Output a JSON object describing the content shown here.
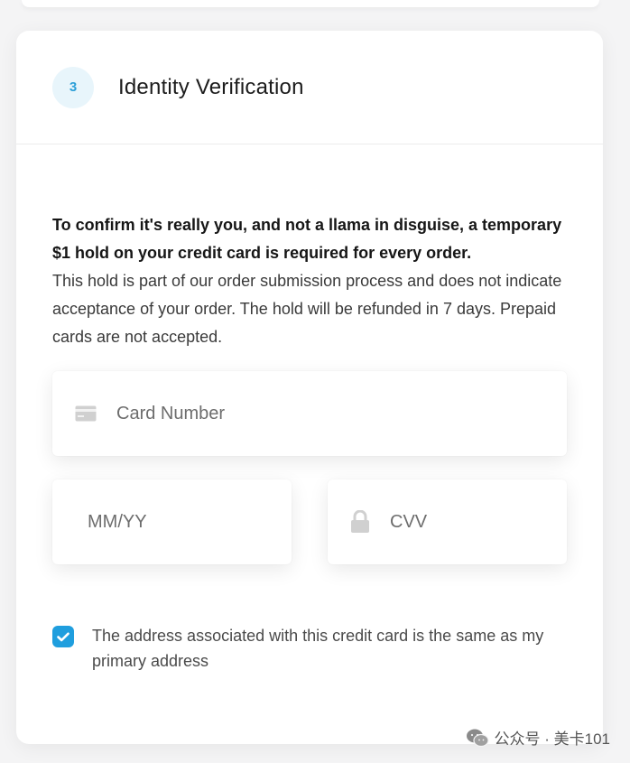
{
  "section": {
    "step_number": "3",
    "title": "Identity Verification"
  },
  "intro": {
    "bold": "To confirm it's really you, and not a llama in disguise, a temporary $1 hold on your credit card is required for every order.",
    "body": "This hold is part of our order submission process and does not indicate acceptance of your order. The hold will be refunded in 7 days. Prepaid cards are not accepted."
  },
  "fields": {
    "card_number_placeholder": "Card Number",
    "expiry_placeholder": "MM/YY",
    "cvv_placeholder": "CVV"
  },
  "checkbox": {
    "checked": true,
    "label": "The address associated with this credit card is the same as my primary address"
  },
  "watermark": {
    "text": "公众号 · 美卡101"
  },
  "colors": {
    "accent": "#1f9ede",
    "step_circle_bg": "#e8f5fb"
  },
  "icons": {
    "card_field": "credit-card-icon",
    "cvv_field": "lock-icon",
    "checkbox": "check-icon",
    "watermark": "wechat-icon"
  }
}
